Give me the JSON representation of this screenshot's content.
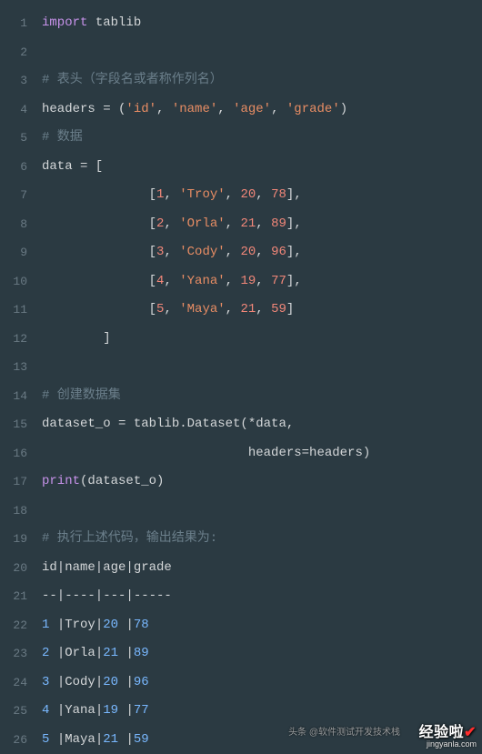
{
  "line_numbers": [
    "1",
    "2",
    "3",
    "4",
    "5",
    "6",
    "7",
    "8",
    "9",
    "10",
    "11",
    "12",
    "13",
    "14",
    "15",
    "16",
    "17",
    "18",
    "19",
    "20",
    "21",
    "22",
    "23",
    "24",
    "25",
    "26"
  ],
  "code": {
    "l1_kw": "import",
    "l1_mod": " tablib",
    "l3_cm": "# 表头（字段名或者称作列名）",
    "l4_a": "headers = (",
    "l4_s1": "'id'",
    "l4_c1": ", ",
    "l4_s2": "'name'",
    "l4_c2": ", ",
    "l4_s3": "'age'",
    "l4_c3": ", ",
    "l4_s4": "'grade'",
    "l4_z": ")",
    "l5_cm": "# 数据",
    "l6": "data = [",
    "indent": "              ",
    "l7_o": "[",
    "l7_n1": "1",
    "l7_c1": ", ",
    "l7_s": "'Troy'",
    "l7_c2": ", ",
    "l7_n2": "20",
    "l7_c3": ", ",
    "l7_n3": "78",
    "l7_z": "],",
    "l8_n1": "2",
    "l8_s": "'Orla'",
    "l8_n2": "21",
    "l8_n3": "89",
    "l9_n1": "3",
    "l9_s": "'Cody'",
    "l9_n2": "20",
    "l9_n3": "96",
    "l10_n1": "4",
    "l10_s": "'Yana'",
    "l10_n2": "19",
    "l10_n3": "77",
    "l11_n1": "5",
    "l11_s": "'Maya'",
    "l11_n2": "21",
    "l11_n3": "59",
    "l11_z": "]",
    "l12": "        ]",
    "l14_cm": "# 创建数据集",
    "l15": "dataset_o = tablib.Dataset(*data,",
    "l16_sp": "                           ",
    "l16": "headers=headers)",
    "l17_fn": "print",
    "l17_z": "(dataset_o)",
    "l19_cm": "# 执行上述代码，输出结果为:",
    "l20": "id|name|age|grade",
    "l21": "--|----|---|-----",
    "l22_n": "1 ",
    "l22_t": "|Troy|",
    "l22_a": "20 ",
    "l22_p": "|",
    "l22_g": "78",
    "l23_n": "2 ",
    "l23_t": "|Orla|",
    "l23_a": "21 ",
    "l23_p": "|",
    "l23_g": "89",
    "l24_n": "3 ",
    "l24_t": "|Cody|",
    "l24_a": "20 ",
    "l24_p": "|",
    "l24_g": "96",
    "l25_n": "4 ",
    "l25_t": "|Yana|",
    "l25_a": "19 ",
    "l25_p": "|",
    "l25_g": "77",
    "l26_n": "5 ",
    "l26_t": "|Maya|",
    "l26_a": "21 ",
    "l26_p": "|",
    "l26_g": "59"
  },
  "watermark": {
    "toutiao": "头条 @软件测试开发技术栈",
    "brand_a": "经验啦",
    "brand_b": "✔",
    "url": "jingyanla.com"
  },
  "chart_data": {
    "type": "table",
    "title": "tablib Dataset example output",
    "headers": [
      "id",
      "name",
      "age",
      "grade"
    ],
    "rows": [
      [
        1,
        "Troy",
        20,
        78
      ],
      [
        2,
        "Orla",
        21,
        89
      ],
      [
        3,
        "Cody",
        20,
        96
      ],
      [
        4,
        "Yana",
        19,
        77
      ],
      [
        5,
        "Maya",
        21,
        59
      ]
    ]
  }
}
